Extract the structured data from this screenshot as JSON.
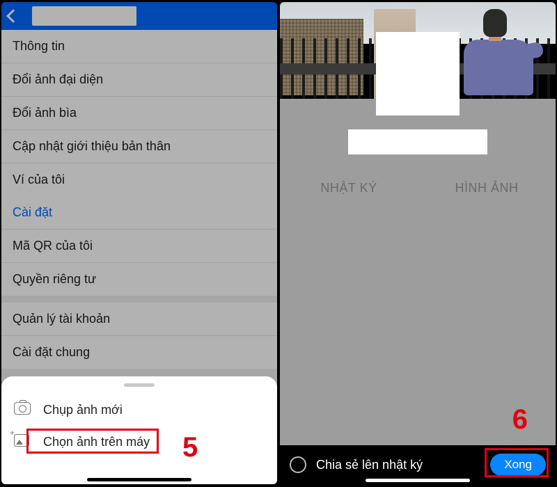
{
  "left": {
    "menu": {
      "info": "Thông tin",
      "change_avatar": "Đổi ảnh đại diện",
      "change_cover": "Đổi ảnh bìa",
      "update_bio": "Cập nhật giới thiệu bản thân",
      "wallet": "Ví của tôi",
      "settings": "Cài đặt",
      "my_qr": "Mã QR của tôi",
      "privacy": "Quyền riêng tư",
      "manage_account": "Quản lý tài khoản",
      "general_settings": "Cài đặt chung"
    },
    "sheet": {
      "take_photo": "Chụp ảnh mới",
      "choose_photo": "Chọn ảnh trên máy"
    },
    "step_label": "5"
  },
  "right": {
    "tabs": {
      "diary": "NHẬT KÝ",
      "photos": "HÌNH ẢNH"
    },
    "share_label": "Chia sẻ lên nhật ký",
    "done_label": "Xong",
    "step_label": "6"
  }
}
